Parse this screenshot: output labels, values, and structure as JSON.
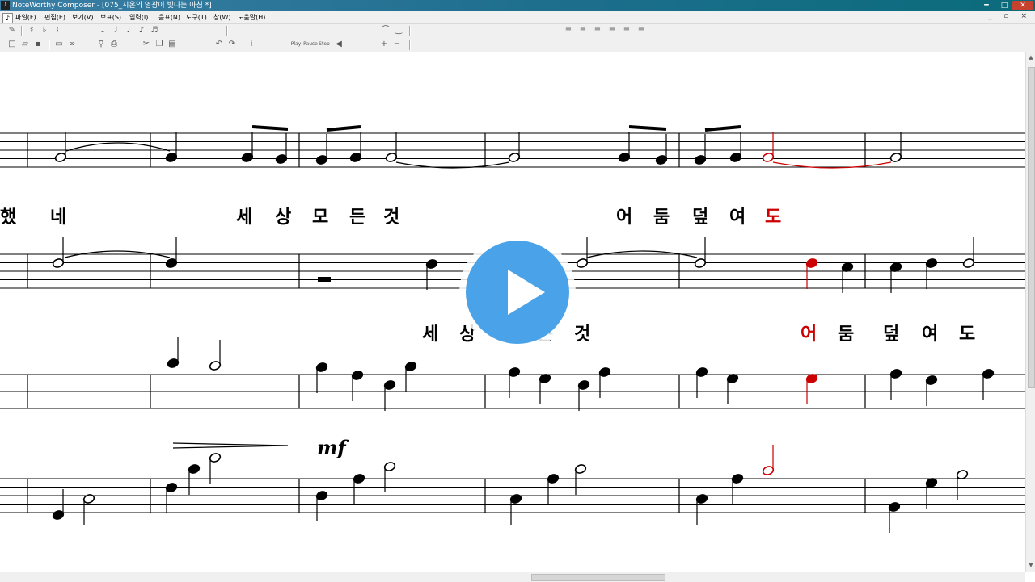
{
  "window": {
    "title": "NoteWorthy Composer - [075_시온의 영광이 빛나는 아침 *]",
    "icon": "nwc-app-icon"
  },
  "window_controls": [
    {
      "name": "minimize-button",
      "glyph": "━"
    },
    {
      "name": "maximize-button",
      "glyph": "□"
    },
    {
      "name": "close-button",
      "glyph": "✕"
    }
  ],
  "menu": [
    {
      "name": "menu-file",
      "label": "파일(F)"
    },
    {
      "name": "menu-edit",
      "label": "편집(E)"
    },
    {
      "name": "menu-view",
      "label": "보기(V)"
    },
    {
      "name": "menu-score",
      "label": "보표(S)"
    },
    {
      "name": "menu-insert",
      "label": "입력(I)"
    },
    {
      "name": "menu-notes",
      "label": "음표(N)"
    },
    {
      "name": "menu-tools",
      "label": "도구(T)"
    },
    {
      "name": "menu-window",
      "label": "창(W)"
    },
    {
      "name": "menu-help",
      "label": "도움말(H)"
    }
  ],
  "mdi_controls": "_ ▫ ×",
  "toolbar": {
    "play_label": "Play",
    "pause_label": "Pause",
    "stop_label": "Stop",
    "note_glyphs": [
      "𝅝",
      "𝅗𝅥",
      "♩",
      "♪",
      "♬"
    ],
    "accidental_glyphs": [
      "♯",
      "♭",
      "♮"
    ]
  },
  "lyrics": {
    "verse1": {
      "syllables": [
        "했",
        "네",
        "세",
        "상",
        "모",
        "든",
        "것",
        "어",
        "둠",
        "덮",
        "여",
        "도"
      ],
      "highlighted": "도"
    },
    "verse2": {
      "syllables": [
        "세",
        "상",
        "모",
        "든",
        "것",
        "어",
        "둠",
        "덮",
        "여",
        "도"
      ],
      "highlighted": "어"
    }
  },
  "dynamics": {
    "marking": "mf"
  },
  "colors": {
    "highlight": "#cc0000",
    "play_button": "#4aa3e8",
    "titlebar": "#1f6f8f"
  },
  "overlay": {
    "icon": "play-icon"
  }
}
